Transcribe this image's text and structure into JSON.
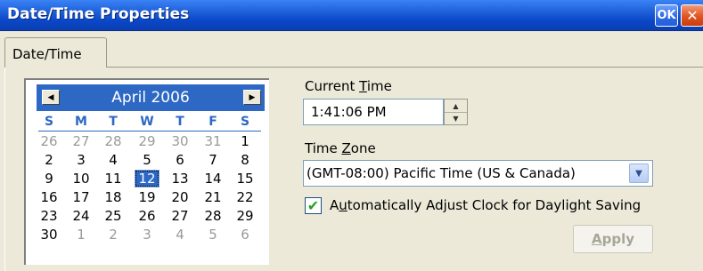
{
  "window": {
    "title": "Date/Time Properties",
    "ok_label": "OK",
    "close_label": "✕"
  },
  "tabs": [
    {
      "label": "Date/Time",
      "active": true
    }
  ],
  "calendar": {
    "month_year": "April 2006",
    "prev_icon": "◀",
    "next_icon": "▶",
    "weekdays": [
      "S",
      "M",
      "T",
      "W",
      "T",
      "F",
      "S"
    ],
    "weeks": [
      [
        "26",
        "27",
        "28",
        "29",
        "30",
        "31",
        "1"
      ],
      [
        "2",
        "3",
        "4",
        "5",
        "6",
        "7",
        "8"
      ],
      [
        "9",
        "10",
        "11",
        "12",
        "13",
        "14",
        "15"
      ],
      [
        "16",
        "17",
        "18",
        "19",
        "20",
        "21",
        "22"
      ],
      [
        "23",
        "24",
        "25",
        "26",
        "27",
        "28",
        "29"
      ],
      [
        "30",
        "1",
        "2",
        "3",
        "4",
        "5",
        "6"
      ]
    ],
    "selected_day": "12",
    "accent_color": "#2d68c4"
  },
  "current_time": {
    "label_prefix": "Current ",
    "label_accel": "T",
    "label_suffix": "ime",
    "value": "1:41:06 PM"
  },
  "time_zone": {
    "label_prefix": "Time ",
    "label_accel": "Z",
    "label_suffix": "one",
    "value": "(GMT-08:00) Pacific Time (US & Canada)"
  },
  "daylight_saving": {
    "label_prefix": "A",
    "label_accel": "u",
    "label_suffix": "tomatically Adjust Clock for Daylight Saving",
    "checked": true
  },
  "apply": {
    "label_accel": "A",
    "label_suffix": "pply",
    "enabled": false
  }
}
